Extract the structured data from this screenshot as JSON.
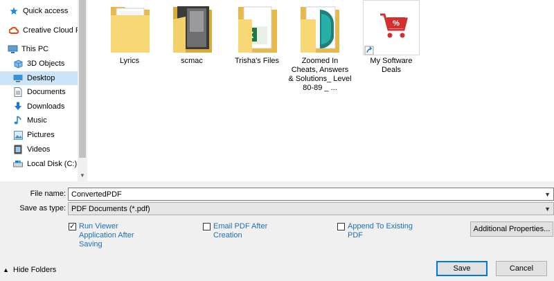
{
  "nav": {
    "items": [
      {
        "label": "Quick access",
        "icon": "star-icon"
      },
      {
        "label": "Creative Cloud Fil",
        "icon": "creative-cloud-icon"
      },
      {
        "label": "This PC",
        "icon": "computer-icon"
      },
      {
        "label": "3D Objects",
        "icon": "cube-icon"
      },
      {
        "label": "Desktop",
        "icon": "desktop-icon"
      },
      {
        "label": "Documents",
        "icon": "documents-icon"
      },
      {
        "label": "Downloads",
        "icon": "download-icon"
      },
      {
        "label": "Music",
        "icon": "music-icon"
      },
      {
        "label": "Pictures",
        "icon": "pictures-icon"
      },
      {
        "label": "Videos",
        "icon": "video-icon"
      },
      {
        "label": "Local Disk (C:)",
        "icon": "disk-icon"
      }
    ],
    "selected": "Desktop"
  },
  "files": [
    {
      "name": "Lyrics",
      "icon": "folder-icon"
    },
    {
      "name": "scmac",
      "icon": "folder-icon"
    },
    {
      "name": "Trisha's Files",
      "icon": "folder-excel-icon"
    },
    {
      "name": "Zoomed In Cheats, Answers & Solutions_ Level 80-89 _ ...",
      "icon": "folder-icon"
    },
    {
      "name": "My Software Deals",
      "icon": "shortcut-cart-icon"
    }
  ],
  "form": {
    "file_name_label": "File name:",
    "file_name_value": "ConvertedPDF",
    "save_type_label": "Save as type:",
    "save_type_value": "PDF Documents (*.pdf)"
  },
  "options": {
    "run_viewer": "Run Viewer Application After Saving",
    "run_viewer_checked": true,
    "email_pdf": "Email PDF After Creation",
    "email_pdf_checked": false,
    "append": "Append To Existing PDF",
    "append_checked": false,
    "additional_properties": "Additional Properties..."
  },
  "buttons": {
    "hide_folders": "Hide Folders",
    "save": "Save",
    "cancel": "Cancel"
  }
}
